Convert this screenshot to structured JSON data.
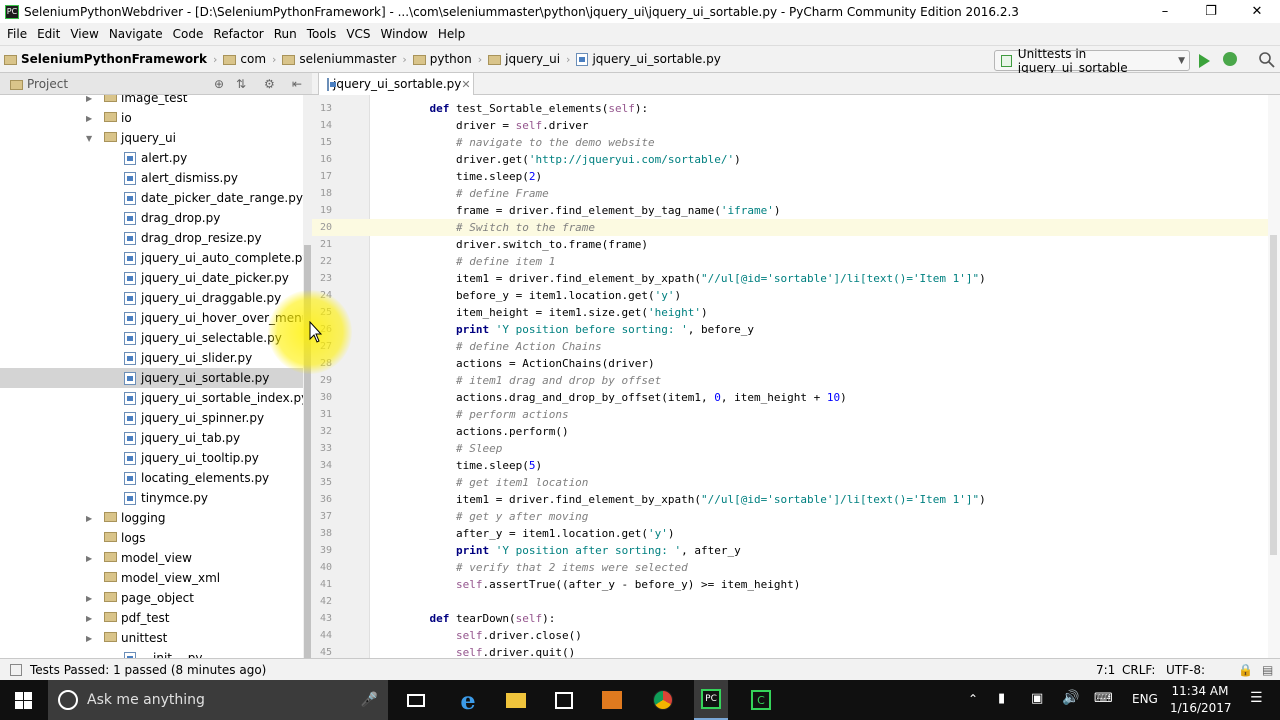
{
  "window": {
    "title": "SeleniumPythonWebdriver - [D:\\SeleniumPythonFramework] - ...\\com\\seleniummaster\\python\\jquery_ui\\jquery_ui_sortable.py - PyCharm Community Edition 2016.2.3",
    "app_icon": "pycharm-icon"
  },
  "menu": [
    "File",
    "Edit",
    "View",
    "Navigate",
    "Code",
    "Refactor",
    "Run",
    "Tools",
    "VCS",
    "Window",
    "Help"
  ],
  "breadcrumb": [
    "SeleniumPythonFramework",
    "com",
    "seleniummaster",
    "python",
    "jquery_ui",
    "jquery_ui_sortable.py"
  ],
  "run_config": "Unittests in jquery_ui_sortable",
  "project_panel": {
    "title": "Project"
  },
  "tree": [
    {
      "label": "image_test",
      "type": "folder",
      "indent": 1,
      "arrow": "right"
    },
    {
      "label": "io",
      "type": "folder",
      "indent": 1,
      "arrow": "right"
    },
    {
      "label": "jquery_ui",
      "type": "folder",
      "indent": 1,
      "arrow": "down"
    },
    {
      "label": "alert.py",
      "type": "file",
      "indent": 2
    },
    {
      "label": "alert_dismiss.py",
      "type": "file",
      "indent": 2
    },
    {
      "label": "date_picker_date_range.py",
      "type": "file",
      "indent": 2
    },
    {
      "label": "drag_drop.py",
      "type": "file",
      "indent": 2
    },
    {
      "label": "drag_drop_resize.py",
      "type": "file",
      "indent": 2
    },
    {
      "label": "jquery_ui_auto_complete.py",
      "type": "file",
      "indent": 2
    },
    {
      "label": "jquery_ui_date_picker.py",
      "type": "file",
      "indent": 2
    },
    {
      "label": "jquery_ui_draggable.py",
      "type": "file",
      "indent": 2
    },
    {
      "label": "jquery_ui_hover_over_menu.py",
      "type": "file",
      "indent": 2
    },
    {
      "label": "jquery_ui_selectable.py",
      "type": "file",
      "indent": 2
    },
    {
      "label": "jquery_ui_slider.py",
      "type": "file",
      "indent": 2
    },
    {
      "label": "jquery_ui_sortable.py",
      "type": "file",
      "indent": 2,
      "selected": true
    },
    {
      "label": "jquery_ui_sortable_index.py",
      "type": "file",
      "indent": 2
    },
    {
      "label": "jquery_ui_spinner.py",
      "type": "file",
      "indent": 2
    },
    {
      "label": "jquery_ui_tab.py",
      "type": "file",
      "indent": 2
    },
    {
      "label": "jquery_ui_tooltip.py",
      "type": "file",
      "indent": 2
    },
    {
      "label": "locating_elements.py",
      "type": "file",
      "indent": 2
    },
    {
      "label": "tinymce.py",
      "type": "file",
      "indent": 2
    },
    {
      "label": "logging",
      "type": "folder",
      "indent": 1,
      "arrow": "right"
    },
    {
      "label": "logs",
      "type": "folder",
      "indent": 1,
      "arrow": "none"
    },
    {
      "label": "model_view",
      "type": "folder",
      "indent": 1,
      "arrow": "right"
    },
    {
      "label": "model_view_xml",
      "type": "folder",
      "indent": 1,
      "arrow": "none"
    },
    {
      "label": "page_object",
      "type": "folder",
      "indent": 1,
      "arrow": "right"
    },
    {
      "label": "pdf_test",
      "type": "folder",
      "indent": 1,
      "arrow": "right"
    },
    {
      "label": "unittest",
      "type": "folder",
      "indent": 1,
      "arrow": "right"
    },
    {
      "label": "__init__.py",
      "type": "file",
      "indent": 2
    }
  ],
  "editor": {
    "tab": "jquery_ui_sortable.py",
    "current_line": 20,
    "lines": [
      {
        "n": "13",
        "t": [
          [
            "    ",
            ""
          ],
          [
            "def ",
            "kw"
          ],
          [
            "test_Sortable_elements(",
            ""
          ],
          [
            "self",
            "sf"
          ],
          [
            "):",
            ""
          ]
        ]
      },
      {
        "n": "14",
        "t": [
          [
            "        driver = ",
            ""
          ],
          [
            "self",
            "sf"
          ],
          [
            ".driver",
            ""
          ]
        ]
      },
      {
        "n": "15",
        "t": [
          [
            "        # navigate to the demo website",
            "cm"
          ]
        ]
      },
      {
        "n": "16",
        "t": [
          [
            "        driver.get(",
            ""
          ],
          [
            "'http://jqueryui.com/sortable/'",
            "st"
          ],
          [
            ")",
            ""
          ]
        ]
      },
      {
        "n": "17",
        "t": [
          [
            "        time.sleep(",
            ""
          ],
          [
            "2",
            "nm"
          ],
          [
            ")",
            ""
          ]
        ]
      },
      {
        "n": "18",
        "t": [
          [
            "        # define Frame",
            "cm"
          ]
        ]
      },
      {
        "n": "19",
        "t": [
          [
            "        frame = driver.find_element_by_tag_name(",
            ""
          ],
          [
            "'iframe'",
            "st"
          ],
          [
            ")",
            ""
          ]
        ]
      },
      {
        "n": "20",
        "t": [
          [
            "        # Switch to the frame",
            "cm"
          ]
        ]
      },
      {
        "n": "21",
        "t": [
          [
            "        driver.switch_to.frame(frame)",
            ""
          ]
        ]
      },
      {
        "n": "22",
        "t": [
          [
            "        # define item 1",
            "cm"
          ]
        ]
      },
      {
        "n": "23",
        "t": [
          [
            "        item1 = driver.find_element_by_xpath(",
            ""
          ],
          [
            "\"//ul[@id='sortable']/li[text()='Item 1']\"",
            "st"
          ],
          [
            ")",
            ""
          ]
        ]
      },
      {
        "n": "24",
        "t": [
          [
            "        before_y = item1.location.get(",
            ""
          ],
          [
            "'y'",
            "st"
          ],
          [
            ")",
            ""
          ]
        ]
      },
      {
        "n": "25",
        "t": [
          [
            "        item_height = item1.size.get(",
            ""
          ],
          [
            "'height'",
            "st"
          ],
          [
            ")",
            ""
          ]
        ]
      },
      {
        "n": "26",
        "t": [
          [
            "        ",
            ""
          ],
          [
            "print ",
            "kw"
          ],
          [
            "'Y position before sorting: '",
            "st"
          ],
          [
            ", before_y",
            ""
          ]
        ]
      },
      {
        "n": "27",
        "t": [
          [
            "        # define Action Chains",
            "cm"
          ]
        ]
      },
      {
        "n": "28",
        "t": [
          [
            "        actions = ActionChains(driver)",
            ""
          ]
        ]
      },
      {
        "n": "29",
        "t": [
          [
            "        # item1 drag and drop by offset",
            "cm"
          ]
        ]
      },
      {
        "n": "30",
        "t": [
          [
            "        actions.drag_and_drop_by_offset(item1, ",
            ""
          ],
          [
            "0",
            "nm"
          ],
          [
            ", item_height + ",
            ""
          ],
          [
            "10",
            "nm"
          ],
          [
            ")",
            ""
          ]
        ]
      },
      {
        "n": "31",
        "t": [
          [
            "        # perform actions",
            "cm"
          ]
        ]
      },
      {
        "n": "32",
        "t": [
          [
            "        actions.perform()",
            ""
          ]
        ]
      },
      {
        "n": "33",
        "t": [
          [
            "        # Sleep",
            "cm"
          ]
        ]
      },
      {
        "n": "34",
        "t": [
          [
            "        time.sleep(",
            ""
          ],
          [
            "5",
            "nm"
          ],
          [
            ")",
            ""
          ]
        ]
      },
      {
        "n": "35",
        "t": [
          [
            "        # get item1 location",
            "cm"
          ]
        ]
      },
      {
        "n": "36",
        "t": [
          [
            "        item1 = driver.find_element_by_xpath(",
            ""
          ],
          [
            "\"//ul[@id='sortable']/li[text()='Item 1']\"",
            "st"
          ],
          [
            ")",
            ""
          ]
        ]
      },
      {
        "n": "37",
        "t": [
          [
            "        # get y after moving",
            "cm"
          ]
        ]
      },
      {
        "n": "38",
        "t": [
          [
            "        after_y = item1.location.get(",
            ""
          ],
          [
            "'y'",
            "st"
          ],
          [
            ")",
            ""
          ]
        ]
      },
      {
        "n": "39",
        "t": [
          [
            "        ",
            ""
          ],
          [
            "print ",
            "kw"
          ],
          [
            "'Y position after sorting: '",
            "st"
          ],
          [
            ", after_y",
            ""
          ]
        ]
      },
      {
        "n": "40",
        "t": [
          [
            "        # verify that 2 items were selected",
            "cm"
          ]
        ]
      },
      {
        "n": "41",
        "t": [
          [
            "        ",
            ""
          ],
          [
            "self",
            "sf"
          ],
          [
            ".assertTrue((after_y - before_y) >= item_height)",
            ""
          ]
        ]
      },
      {
        "n": "42",
        "t": [
          [
            "",
            ""
          ]
        ]
      },
      {
        "n": "43",
        "t": [
          [
            "    ",
            ""
          ],
          [
            "def ",
            "kw"
          ],
          [
            "tearDown(",
            ""
          ],
          [
            "self",
            "sf"
          ],
          [
            "):",
            ""
          ]
        ]
      },
      {
        "n": "44",
        "t": [
          [
            "        ",
            ""
          ],
          [
            "self",
            "sf"
          ],
          [
            ".driver.close()",
            ""
          ]
        ]
      },
      {
        "n": "45",
        "t": [
          [
            "        ",
            ""
          ],
          [
            "self",
            "sf"
          ],
          [
            ".driver.quit()",
            ""
          ]
        ]
      }
    ]
  },
  "status": {
    "message": "Tests Passed: 1 passed (8 minutes ago)",
    "position": "7:1",
    "line_sep": "CRLF:",
    "encoding": "UTF-8:"
  },
  "taskbar": {
    "search_placeholder": "Ask me anything",
    "lang": "ENG",
    "time": "11:34 AM",
    "date": "1/16/2017"
  }
}
